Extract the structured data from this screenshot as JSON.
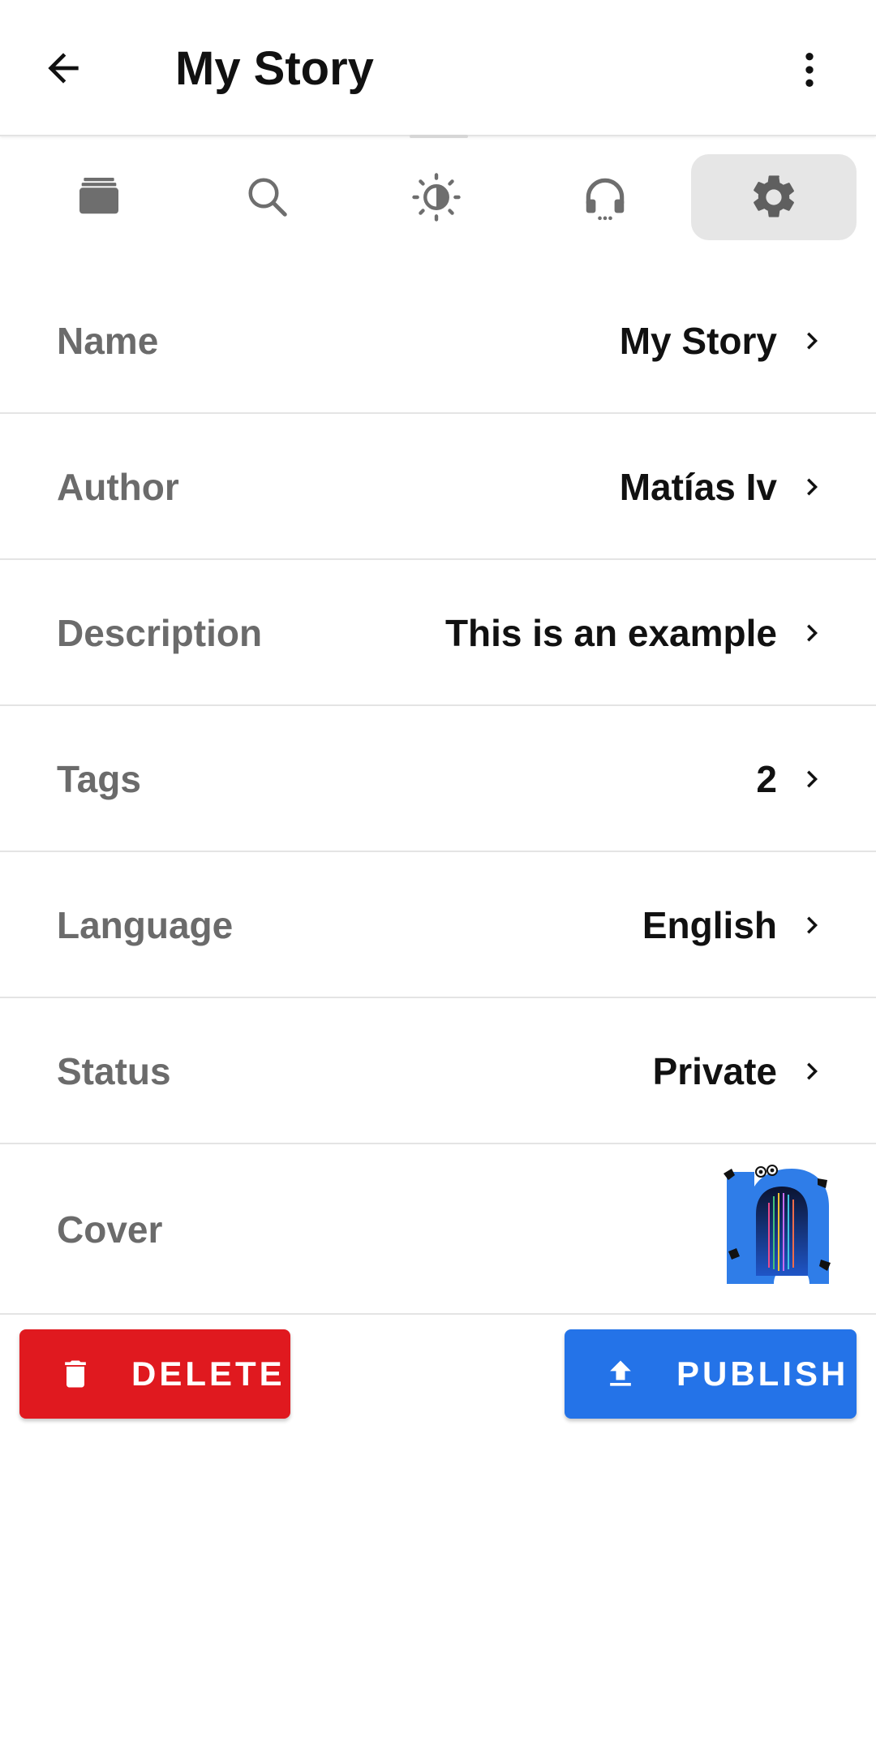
{
  "app_bar": {
    "title": "My Story",
    "back_icon": "arrow-left-icon",
    "menu_icon": "more-vertical-icon"
  },
  "tabs": [
    {
      "icon": "library-stack-icon",
      "active": false
    },
    {
      "icon": "search-icon",
      "active": false
    },
    {
      "icon": "brightness-icon",
      "active": false
    },
    {
      "icon": "headphones-icon",
      "active": false
    },
    {
      "icon": "gear-icon",
      "active": true
    }
  ],
  "settings": {
    "name": {
      "label": "Name",
      "value": "My Story"
    },
    "author": {
      "label": "Author",
      "value": "Matías Iv"
    },
    "description": {
      "label": "Description",
      "value": "This is an example"
    },
    "tags": {
      "label": "Tags",
      "value": "2"
    },
    "language": {
      "label": "Language",
      "value": "English"
    },
    "status": {
      "label": "Status",
      "value": "Private"
    },
    "cover": {
      "label": "Cover"
    }
  },
  "actions": {
    "delete_label": "DELETE",
    "publish_label": "PUBLISH"
  },
  "colors": {
    "delete": "#e0191f",
    "publish": "#2473e8",
    "label_gray": "#6b6b6b",
    "value_black": "#111111",
    "active_tab_bg": "#e6e6e6"
  }
}
